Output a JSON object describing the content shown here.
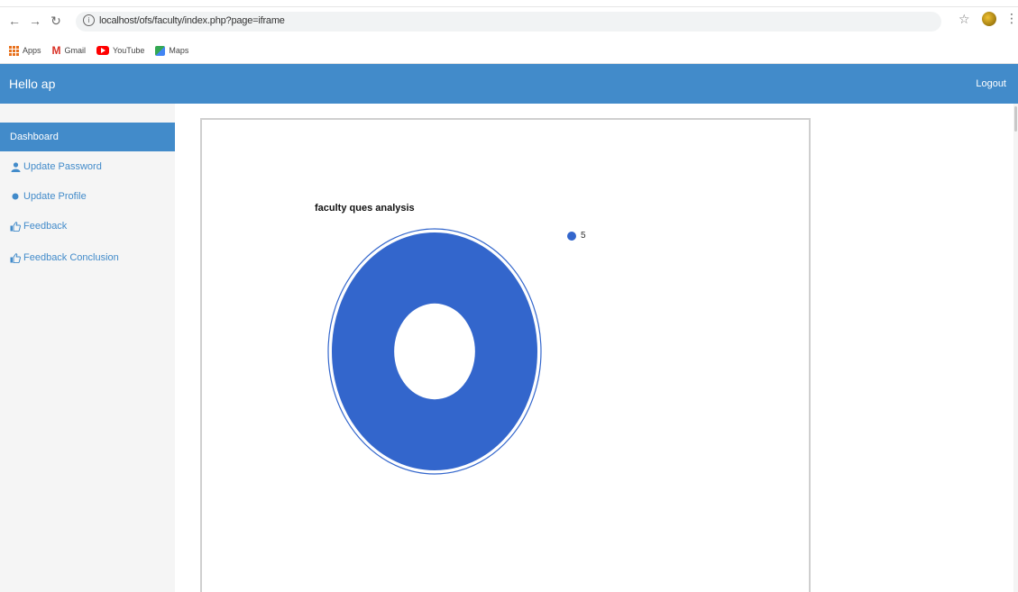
{
  "browser": {
    "url": "localhost/ofs/faculty/index.php?page=iframe",
    "bookmarks": [
      {
        "label": "Apps"
      },
      {
        "label": "Gmail"
      },
      {
        "label": "YouTube"
      },
      {
        "label": "Maps"
      }
    ]
  },
  "header": {
    "title": "Hello ap",
    "logout_label": "Logout"
  },
  "sidebar": {
    "items": [
      {
        "label": "Dashboard",
        "icon": "",
        "active": true
      },
      {
        "label": "Update Password",
        "icon": "user-icon"
      },
      {
        "label": "Update Profile",
        "icon": "dot-icon"
      },
      {
        "label": "Feedback",
        "icon": "thumbs-up-icon"
      },
      {
        "label": "Feedback Conclusion",
        "icon": "thumbs-up-icon"
      }
    ]
  },
  "colors": {
    "accent": "#428bca",
    "sidebar_bg": "#f5f5f5",
    "slice": "#3366cc"
  },
  "chart_data": {
    "type": "pie",
    "title": "faculty ques analysis",
    "labels": [
      "5"
    ],
    "values": [
      1
    ],
    "legend_position": "right",
    "donut": true
  }
}
